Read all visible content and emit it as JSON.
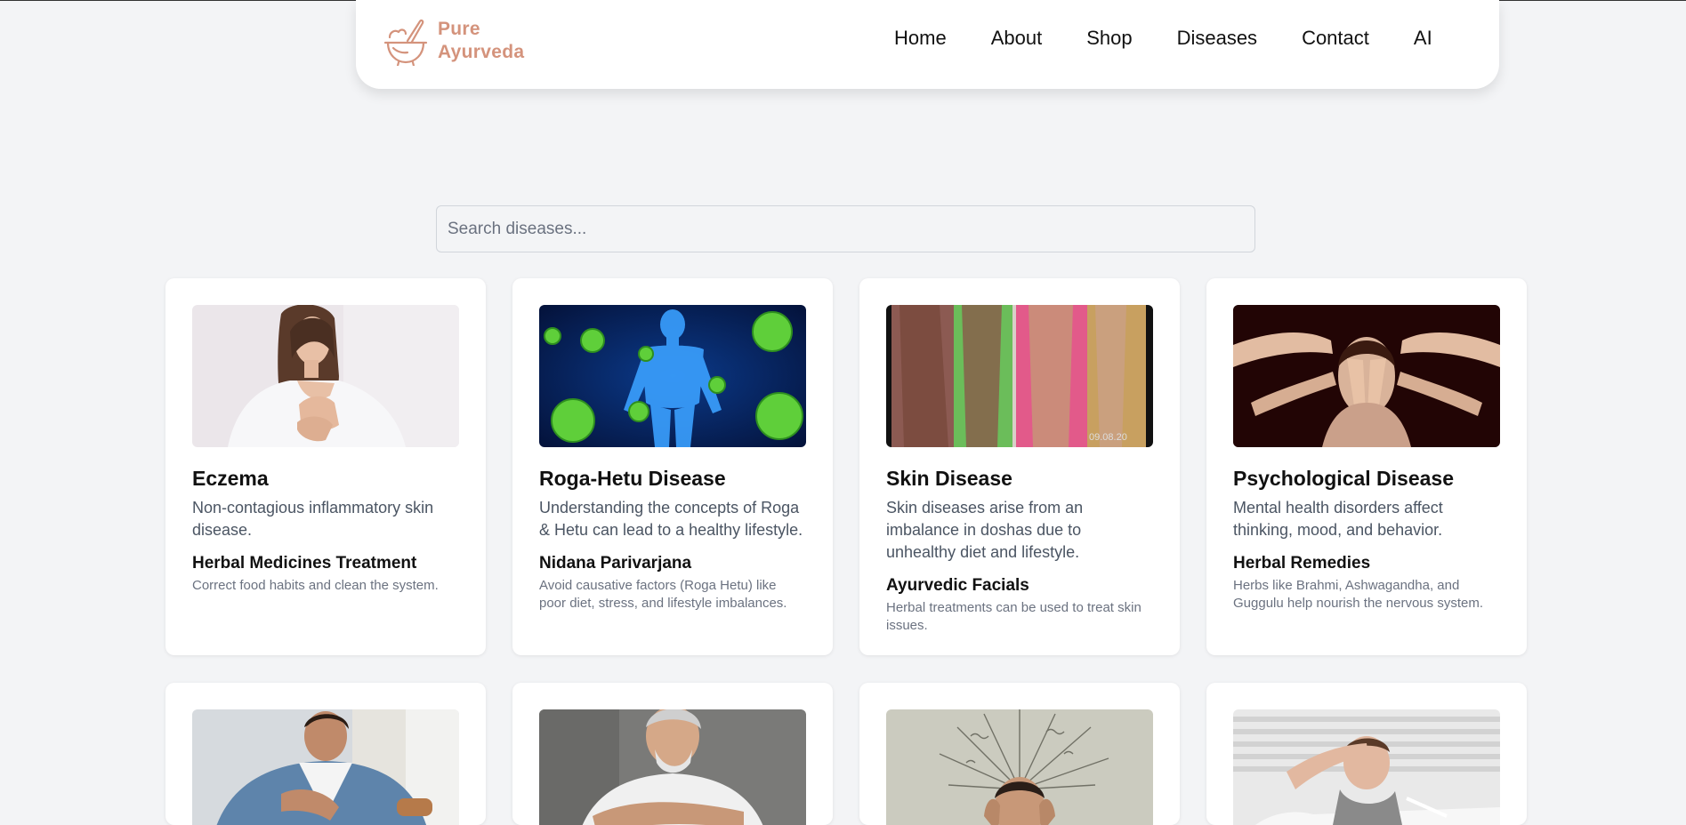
{
  "brand": {
    "line1": "Pure",
    "line2": "Ayurveda",
    "logo_icon": "mortar-pestle-icon",
    "color": "#d4937c"
  },
  "nav": {
    "items": [
      "Home",
      "About",
      "Shop",
      "Diseases",
      "Contact",
      "AI"
    ]
  },
  "search": {
    "placeholder": "Search diseases..."
  },
  "cards": [
    {
      "title": "Eczema",
      "description": "Non-contagious inflammatory skin disease.",
      "subtitle": "Herbal Medicines Treatment",
      "note": "Correct food habits and clean the system."
    },
    {
      "title": "Roga-Hetu Disease",
      "description": "Understanding the concepts of Roga & Hetu can lead to a healthy lifestyle.",
      "subtitle": "Nidana Parivarjana",
      "note": "Avoid causative factors (Roga Hetu) like poor diet, stress, and lifestyle imbalances."
    },
    {
      "title": "Skin Disease",
      "description": "Skin diseases arise from an imbalance in doshas due to unhealthy diet and lifestyle.",
      "subtitle": "Ayurvedic Facials",
      "note": "Herbal treatments can be used to treat skin issues."
    },
    {
      "title": "Psychological Disease",
      "description": "Mental health disorders affect thinking, mood, and behavior.",
      "subtitle": "Herbal Remedies",
      "note": "Herbs like Brahmi, Ashwagandha, and Guggulu help nourish the nervous system."
    }
  ],
  "image_watermark": "09.08.20"
}
